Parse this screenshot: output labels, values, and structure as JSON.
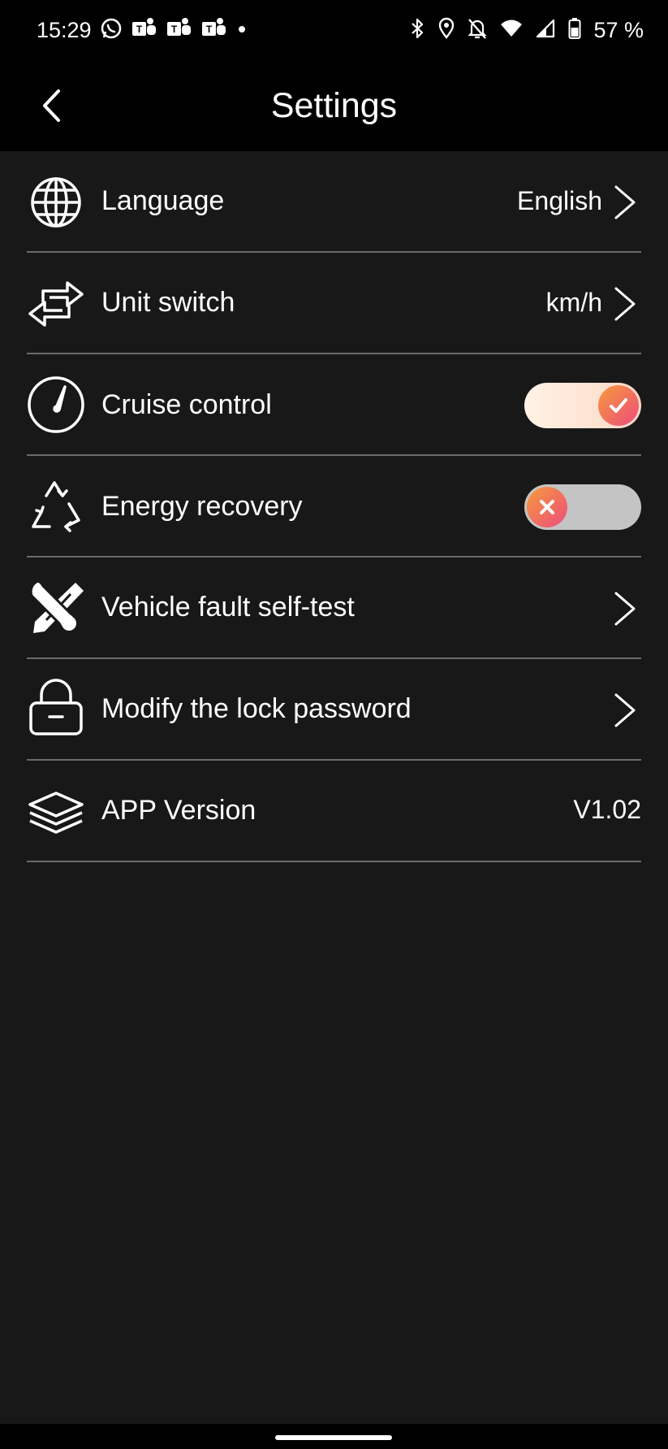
{
  "status_bar": {
    "time": "15:29",
    "battery_percent": "57 %",
    "left_icons": [
      "whatsapp-icon",
      "teams-icon",
      "teams-icon",
      "teams-icon",
      "dot-icon"
    ],
    "right_icons": [
      "bluetooth-icon",
      "location-icon",
      "bell-off-icon",
      "wifi-icon",
      "signal-icon",
      "battery-icon"
    ]
  },
  "header": {
    "title": "Settings"
  },
  "settings": {
    "language": {
      "label": "Language",
      "value": "English",
      "icon": "globe-icon"
    },
    "unit_switch": {
      "label": "Unit switch",
      "value": "km/h",
      "icon": "swap-arrows-icon"
    },
    "cruise_control": {
      "label": "Cruise control",
      "enabled": true,
      "icon": "speedometer-icon"
    },
    "energy_recovery": {
      "label": "Energy recovery",
      "enabled": false,
      "icon": "recycle-icon"
    },
    "fault_self_test": {
      "label": "Vehicle fault self-test",
      "icon": "tools-icon"
    },
    "lock_password": {
      "label": "Modify the lock password",
      "icon": "lock-icon"
    },
    "app_version": {
      "label": "APP Version",
      "value": "V1.02",
      "icon": "layers-icon"
    }
  },
  "colors": {
    "background": "#181818",
    "header_background": "#000000",
    "divider": "#6a6a6a",
    "toggle_knob_start": "#f59a3c",
    "toggle_knob_end": "#ee4c7c",
    "toggle_on_track": "#fdd8c6",
    "toggle_off_track": "#c4c4c4"
  }
}
